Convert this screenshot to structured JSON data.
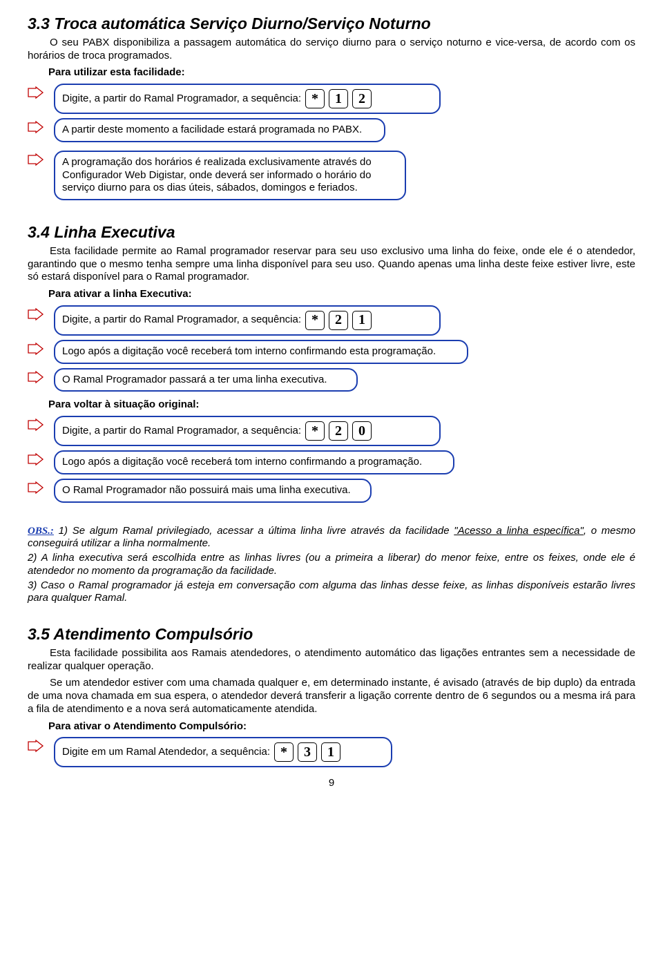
{
  "section33": {
    "title": "3.3 Troca automática Serviço Diurno/Serviço Noturno",
    "intro": "O seu PABX disponibiliza a passagem automática do serviço diurno para o serviço noturno e vice-versa, de acordo com os horários de troca programados.",
    "label_use": "Para utilizar esta facilidade:",
    "step1_text": "Digite, a partir do Ramal Programador, a sequência:",
    "step1_keys": [
      "*",
      "1",
      "2"
    ],
    "step2_text": "A partir deste momento a facilidade estará programada no PABX.",
    "step3_text": "A programação dos horários é realizada exclusivamente através do Configurador Web Digistar, onde deverá ser informado o horário do serviço diurno para os dias úteis, sábados, domingos e feriados."
  },
  "section34": {
    "title": "3.4 Linha Executiva",
    "intro": "Esta facilidade permite ao Ramal programador reservar para seu uso exclusivo uma linha do feixe, onde ele é o atendedor, garantindo que o mesmo tenha sempre uma linha disponível para seu uso. Quando apenas uma linha deste feixe estiver livre, este só estará disponível para o Ramal programador.",
    "label_activate": "Para ativar a linha Executiva:",
    "stepA1_text": "Digite, a partir do Ramal Programador, a sequência:",
    "stepA1_keys": [
      "*",
      "2",
      "1"
    ],
    "stepA2_text": "Logo após a digitação você receberá tom interno confirmando esta programação.",
    "stepA3_text": "O Ramal Programador passará a ter uma linha executiva.",
    "label_reset": "Para voltar à situação original:",
    "stepB1_text": "Digite, a partir do Ramal Programador, a sequência:",
    "stepB1_keys": [
      "*",
      "2",
      "0"
    ],
    "stepB2_text": "Logo após a digitação você receberá tom interno confirmando a programação.",
    "stepB3_text": "O Ramal Programador não possuirá mais uma linha executiva."
  },
  "obs": {
    "label": "OBS.:",
    "n1_pre": " 1) Se algum Ramal privilegiado, acessar a última linha livre através da facilidade ",
    "n1_link": "\"Acesso a linha específica\"",
    "n1_post": ", o mesmo conseguirá utilizar a linha normalmente.",
    "n2": "2) A linha executiva será escolhida entre as linhas livres (ou a primeira a liberar) do menor feixe, entre os feixes, onde ele é atendedor no momento da programação da facilidade.",
    "n3": "3) Caso o Ramal programador já esteja em conversação com alguma das linhas desse feixe, as linhas disponíveis estarão livres para qualquer Ramal."
  },
  "section35": {
    "title": "3.5 Atendimento Compulsório",
    "intro1": "Esta facilidade possibilita aos Ramais atendedores, o atendimento automático das ligações entrantes sem a necessidade de realizar qualquer operação.",
    "intro2": "Se um atendedor estiver com uma chamada qualquer e, em determinado instante, é avisado (através de bip duplo) da entrada de uma nova chamada em sua espera, o atendedor deverá transferir a ligação corrente dentro de 6 segundos ou a mesma irá para a fila de atendimento e a nova será automaticamente atendida.",
    "label_activate": "Para ativar o Atendimento Compulsório:",
    "step1_text": "Digite em um Ramal Atendedor, a sequência:",
    "step1_keys": [
      "*",
      "3",
      "1"
    ]
  },
  "page_number": "9"
}
